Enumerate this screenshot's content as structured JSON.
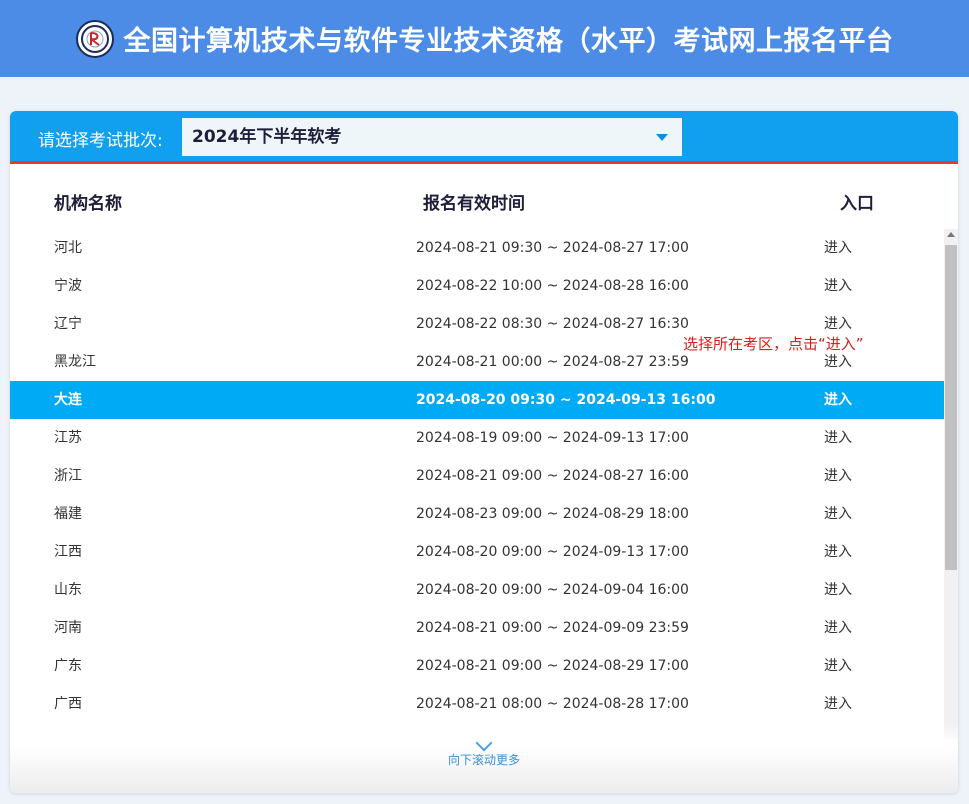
{
  "header": {
    "title": "全国计算机技术与软件专业技术资格（水平）考试网上报名平台",
    "logo_icon": "exam-seal-logo"
  },
  "batch": {
    "label": "请选择考试批次:",
    "selected": "2024年下半年软考"
  },
  "table": {
    "headers": [
      "机构名称",
      "报名有效时间",
      "入口"
    ],
    "rows": [
      {
        "name": "河北",
        "time": "2024-08-21 09:30 ~ 2024-08-27 17:00",
        "entry": "进入"
      },
      {
        "name": "宁波",
        "time": "2024-08-22 10:00 ~ 2024-08-28 16:00",
        "entry": "进入"
      },
      {
        "name": "辽宁",
        "time": "2024-08-22 08:30 ~ 2024-08-27 16:30",
        "entry": "进入"
      },
      {
        "name": "黑龙江",
        "time": "2024-08-21 00:00 ~ 2024-08-27 23:59",
        "entry": "进入"
      },
      {
        "name": "大连",
        "time": "2024-08-20 09:30 ~ 2024-09-13 16:00",
        "entry": "进入"
      },
      {
        "name": "江苏",
        "time": "2024-08-19 09:00 ~ 2024-09-13 17:00",
        "entry": "进入"
      },
      {
        "name": "浙江",
        "time": "2024-08-21 09:00 ~ 2024-08-27 16:00",
        "entry": "进入"
      },
      {
        "name": "福建",
        "time": "2024-08-23 09:00 ~ 2024-08-29 18:00",
        "entry": "进入"
      },
      {
        "name": "江西",
        "time": "2024-08-20 09:00 ~ 2024-09-13 17:00",
        "entry": "进入"
      },
      {
        "name": "山东",
        "time": "2024-08-20 09:00 ~ 2024-09-04 16:00",
        "entry": "进入"
      },
      {
        "name": "河南",
        "time": "2024-08-21 09:00 ~ 2024-09-09 23:59",
        "entry": "进入"
      },
      {
        "name": "广东",
        "time": "2024-08-21 09:00 ~ 2024-08-29 17:00",
        "entry": "进入"
      },
      {
        "name": "广西",
        "time": "2024-08-21 08:00 ~ 2024-08-28 17:00",
        "entry": "进入"
      }
    ],
    "selected_row": "大连"
  },
  "hint": "选择所在考区，点击“进入”",
  "scroll_more": "向下滚动更多",
  "colors": {
    "banner": "#4c8ce6",
    "panel_header": "#10a0ef",
    "selected_row": "#00aaf4",
    "hint": "#d81e1e"
  }
}
